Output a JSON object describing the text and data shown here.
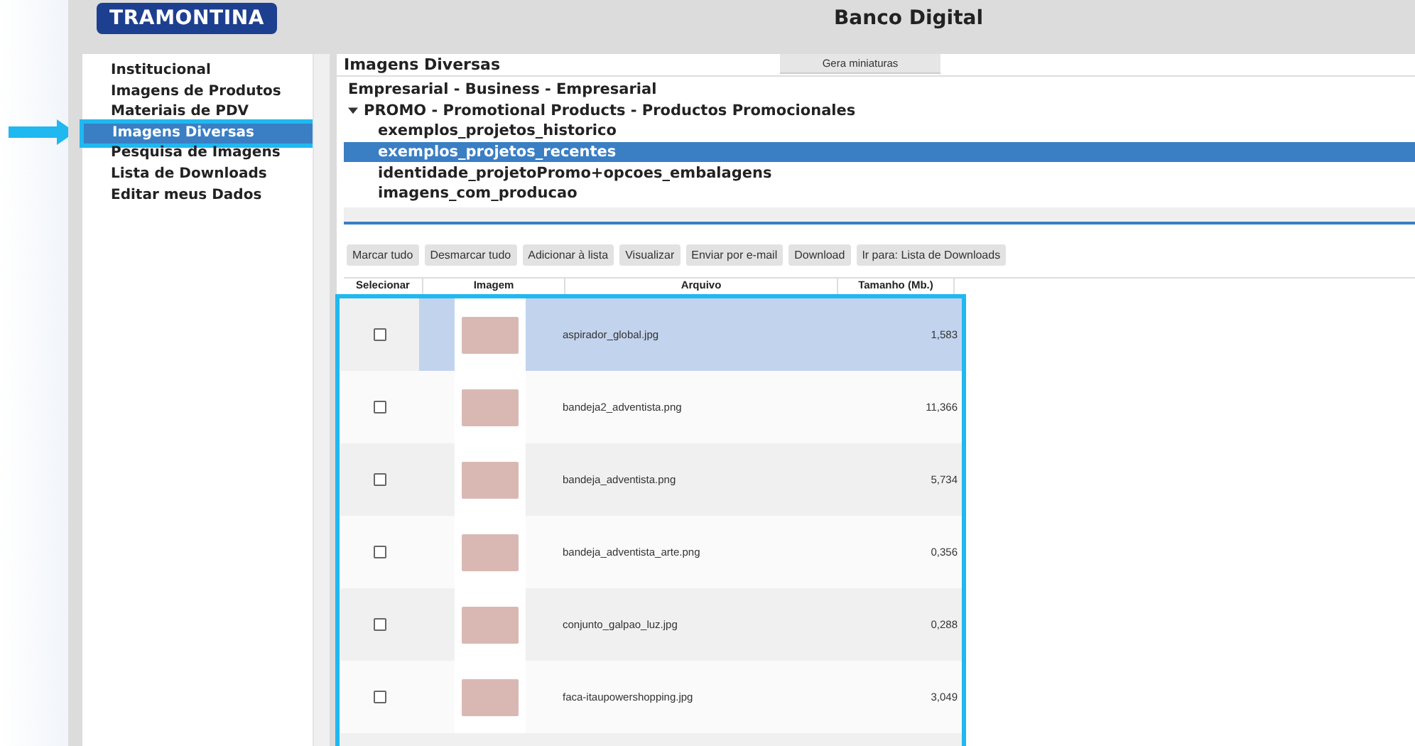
{
  "header": {
    "logo": "TRAMONTINA",
    "title": "Banco Digital"
  },
  "sidebar": {
    "items": [
      {
        "label": "Institucional",
        "selected": false
      },
      {
        "label": "Imagens de Produtos",
        "selected": false
      },
      {
        "label": "Materiais de PDV",
        "selected": false
      },
      {
        "label": "Imagens Diversas",
        "selected": true
      },
      {
        "label": "Pesquisa de Imagens",
        "selected": false
      },
      {
        "label": "Lista de Downloads",
        "selected": false
      },
      {
        "label": "Editar meus Dados",
        "selected": false
      }
    ]
  },
  "main": {
    "title": "Imagens Diversas",
    "tab": "Gera miniaturas",
    "tree": [
      {
        "label": "Empresarial - Business - Empresarial",
        "selected": false
      },
      {
        "label": "PROMO - Promotional Products - Productos Promocionales",
        "selected": false,
        "expanded": true,
        "children": [
          {
            "label": "exemplos_projetos_historico",
            "selected": false
          },
          {
            "label": "exemplos_projetos_recentes",
            "selected": true
          },
          {
            "label": "identidade_projetoPromo+opcoes_embalagens",
            "selected": false
          },
          {
            "label": "imagens_com_producao",
            "selected": false
          }
        ]
      }
    ],
    "toolbar": [
      "Marcar tudo",
      "Desmarcar tudo",
      "Adicionar à lista",
      "Visualizar",
      "Enviar por e-mail",
      "Download",
      "Ir para: Lista de Downloads"
    ],
    "table": {
      "columns": [
        "Selecionar",
        "Imagem",
        "Arquivo",
        "Tamanho (Mb.)"
      ],
      "rows": [
        {
          "file": "aspirador_global.jpg",
          "size": "1,583",
          "selected": true,
          "checked": false
        },
        {
          "file": "bandeja2_adventista.png",
          "size": "11,366",
          "selected": false,
          "checked": false
        },
        {
          "file": "bandeja_adventista.png",
          "size": "5,734",
          "selected": false,
          "checked": false
        },
        {
          "file": "bandeja_adventista_arte.png",
          "size": "0,356",
          "selected": false,
          "checked": false
        },
        {
          "file": "conjunto_galpao_luz.jpg",
          "size": "0,288",
          "selected": false,
          "checked": false
        },
        {
          "file": "faca-itaupowershopping.jpg",
          "size": "3,049",
          "selected": false,
          "checked": false
        }
      ]
    }
  }
}
